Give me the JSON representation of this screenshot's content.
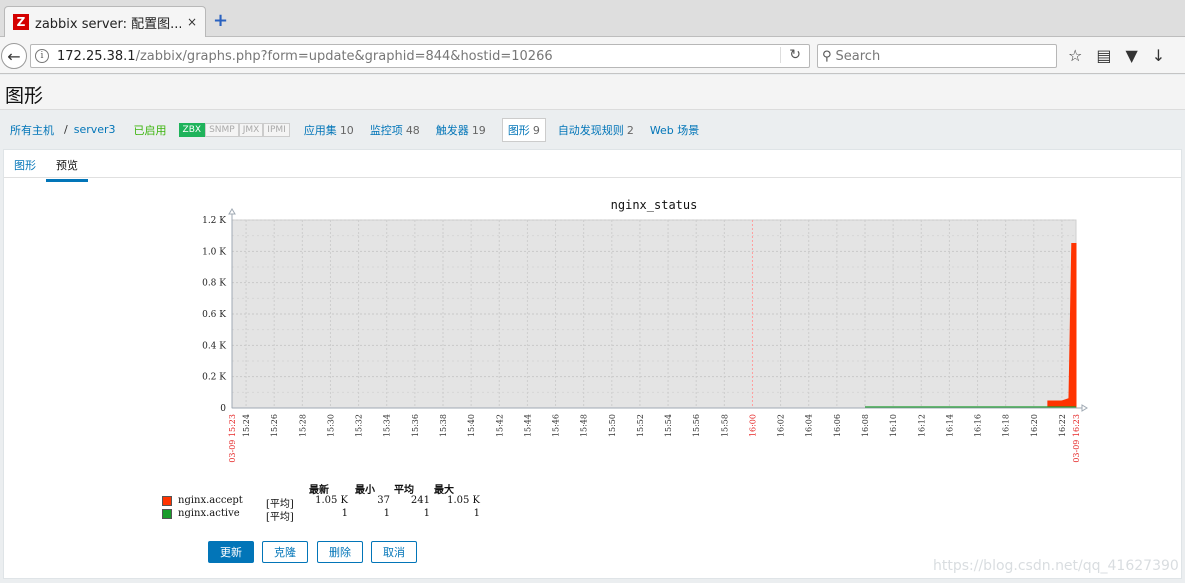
{
  "browser": {
    "tab_title": "zabbix server: 配置图...",
    "tab_close": "×",
    "favicon_letter": "Z",
    "new_tab": "+",
    "url_host": "172.25.38.1",
    "url_path": "/zabbix/graphs.php?form=update&graphid=844&hostid=10266",
    "search_placeholder": "Search"
  },
  "page": {
    "title": "图形"
  },
  "host_nav": {
    "all_hosts": "所有主机",
    "separator": "/",
    "host": "server3",
    "status": "已启用",
    "availability": [
      "ZBX",
      "SNMP",
      "JMX",
      "IPMI"
    ],
    "items": [
      {
        "label": "应用集",
        "count": "10"
      },
      {
        "label": "监控项",
        "count": "48"
      },
      {
        "label": "触发器",
        "count": "19"
      },
      {
        "label": "图形",
        "count": "9"
      },
      {
        "label": "自动发现规则",
        "count": "2"
      },
      {
        "label": "Web 场景",
        "count": ""
      }
    ]
  },
  "subtabs": [
    "图形",
    "预览"
  ],
  "chart_data": {
    "type": "area",
    "title": "nginx_status",
    "y_tick_labels": [
      "1.2 K",
      "1.0 K",
      "0.8 K",
      "0.6 K",
      "0.4 K",
      "0.2 K",
      "0"
    ],
    "ylim": [
      0,
      1200
    ],
    "x_tick_labels": [
      "03-09 15:23",
      "15:24",
      "15:26",
      "15:28",
      "15:30",
      "15:32",
      "15:34",
      "15:36",
      "15:38",
      "15:40",
      "15:42",
      "15:44",
      "15:46",
      "15:48",
      "15:50",
      "15:52",
      "15:54",
      "15:56",
      "15:58",
      "16:00",
      "16:02",
      "16:04",
      "16:06",
      "16:08",
      "16:10",
      "16:12",
      "16:14",
      "16:16",
      "16:18",
      "16:20",
      "16:22",
      "03-09 16:23"
    ],
    "x_tick_red": [
      "03-09 15:23",
      "16:00",
      "03-09 16:23"
    ],
    "grid": true,
    "series": [
      {
        "name": "nginx.accept",
        "color": "#ff3300",
        "points": [
          [
            "16:21",
            45
          ],
          [
            "16:22",
            45
          ],
          [
            "16:22.5",
            60
          ],
          [
            "16:22.7",
            1050
          ],
          [
            "16:23",
            1050
          ]
        ]
      },
      {
        "name": "nginx.active",
        "color": "#1a9c2b",
        "points": [
          [
            "16:08",
            1
          ],
          [
            "16:23",
            1
          ]
        ]
      }
    ]
  },
  "legend": {
    "headers": [
      "最新",
      "最小",
      "平均",
      "最大"
    ],
    "rows": [
      {
        "name": "nginx.accept",
        "func": "[平均]",
        "last": "1.05 K",
        "min": "37",
        "avg": "241",
        "max": "1.05 K",
        "color": "#ff3300"
      },
      {
        "name": "nginx.active",
        "func": "[平均]",
        "last": "1",
        "min": "1",
        "avg": "1",
        "max": "1",
        "color": "#1a9c2b"
      }
    ]
  },
  "buttons": {
    "update": "更新",
    "clone": "克隆",
    "delete": "删除",
    "cancel": "取消"
  },
  "watermark": "https://blog.csdn.net/qq_41627390"
}
